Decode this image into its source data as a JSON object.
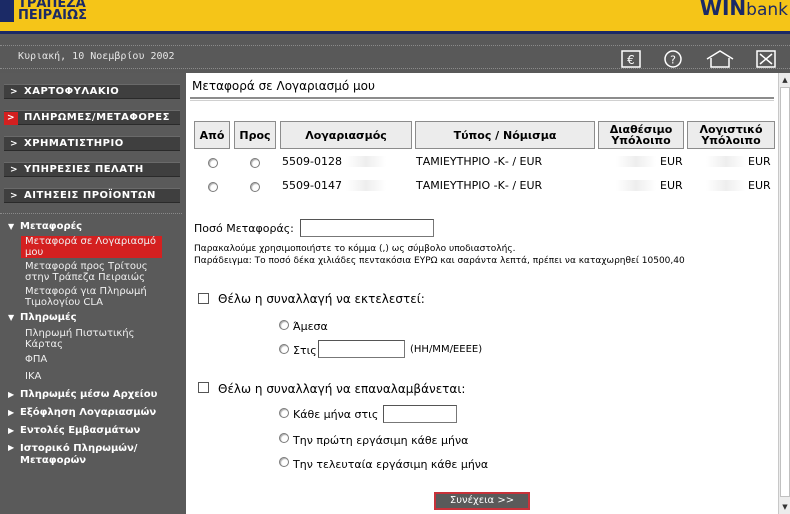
{
  "header": {
    "bank_name_line1": "ΤΡΑΠΕΖΑ",
    "bank_name_line2": "ΠΕΙΡΑΙΩΣ",
    "brand_win": "WIN",
    "brand_bank": "bank"
  },
  "subbar": {
    "date": "Κυριακή, 10 Νοεμβρίου 2002",
    "icons": [
      "euro-icon",
      "help-icon",
      "home-icon",
      "close-icon"
    ]
  },
  "sidebar": {
    "menu": [
      {
        "label": "ΧΑΡΤΟΦΥΛΑΚΙΟ",
        "active": false
      },
      {
        "label": "ΠΛΗΡΩΜΕΣ/ΜΕΤΑΦΟΡΕΣ",
        "active": true
      },
      {
        "label": "ΧΡΗΜΑΤΙΣΤΗΡΙΟ",
        "active": false
      },
      {
        "label": "ΥΠΗΡΕΣΙΕΣ ΠΕΛΑΤΗ",
        "active": false
      },
      {
        "label": "ΑΙΤΗΣΕΙΣ ΠΡΟΪΟΝΤΩΝ",
        "active": false
      }
    ],
    "transfers_head": "Μεταφορές",
    "transfers": [
      {
        "label": "Μεταφορά σε Λογαριασμό μου"
      },
      {
        "label": "Μεταφορά προς Τρίτους στην Τράπεζα Πειραιώς"
      },
      {
        "label": "Μεταφορά για Πληρωμή Τιμολογίου CLA"
      }
    ],
    "payments_head": "Πληρωμές",
    "payments": [
      {
        "label": "Πληρωμή Πιστωτικής Κάρτας"
      },
      {
        "label": "ΦΠΑ"
      },
      {
        "label": "ΙΚΑ"
      }
    ],
    "more": [
      {
        "label": "Πληρωμές μέσω Αρχείου"
      },
      {
        "label": "Εξόφληση Λογαριασμών"
      },
      {
        "label": "Εντολές Εμβασμάτων"
      },
      {
        "label": "Ιστορικό Πληρωμών/Μεταφορών"
      }
    ]
  },
  "main": {
    "title": "Μεταφορά σε Λογαριασμό μου",
    "table": {
      "headers": [
        "Από",
        "Προς",
        "Λογαριασμός",
        "Τύπος / Νόμισμα",
        "Διαθέσιμο Υπόλοιπο",
        "Λογιστικό Υπόλοιπο"
      ],
      "rows": [
        {
          "account": "5509-0128",
          "type": "ΤΑΜΙΕΥΤΗΡΙΟ -Κ- / EUR",
          "available_currency": "EUR",
          "ledger_currency": "EUR"
        },
        {
          "account": "5509-0147",
          "type": "ΤΑΜΙΕΥΤΗΡΙΟ -Κ- / EUR",
          "available_currency": "EUR",
          "ledger_currency": "EUR"
        }
      ]
    },
    "amount_label": "Ποσό Μεταφοράς:",
    "amount_value": "",
    "note1": "Παρακαλούμε χρησιμοποιήστε το κόμμα (,) ως σύμβολο υποδιαστολής.",
    "note2": "Παράδειγμα: Το ποσό δέκα χιλιάδες πεντακόσια ΕΥΡΩ και σαράντα λεπτά, πρέπει να καταχωρηθεί 10500,40",
    "execute_label": "Θέλω η συναλλαγή να εκτελεστεί:",
    "immediately": "Άμεσα",
    "on_date": "Στις",
    "date_format": "(ΗΗ/ΜΜ/ΕΕΕΕ)",
    "repeat_label": "Θέλω η συναλλαγή να επαναλαμβάνεται:",
    "every_month_on": "Κάθε μήνα στις",
    "first_workday": "Την πρώτη εργάσιμη κάθε μήνα",
    "last_workday": "Την τελευταία εργάσιμη κάθε μήνα",
    "continue": "Συνέχεια >>"
  }
}
